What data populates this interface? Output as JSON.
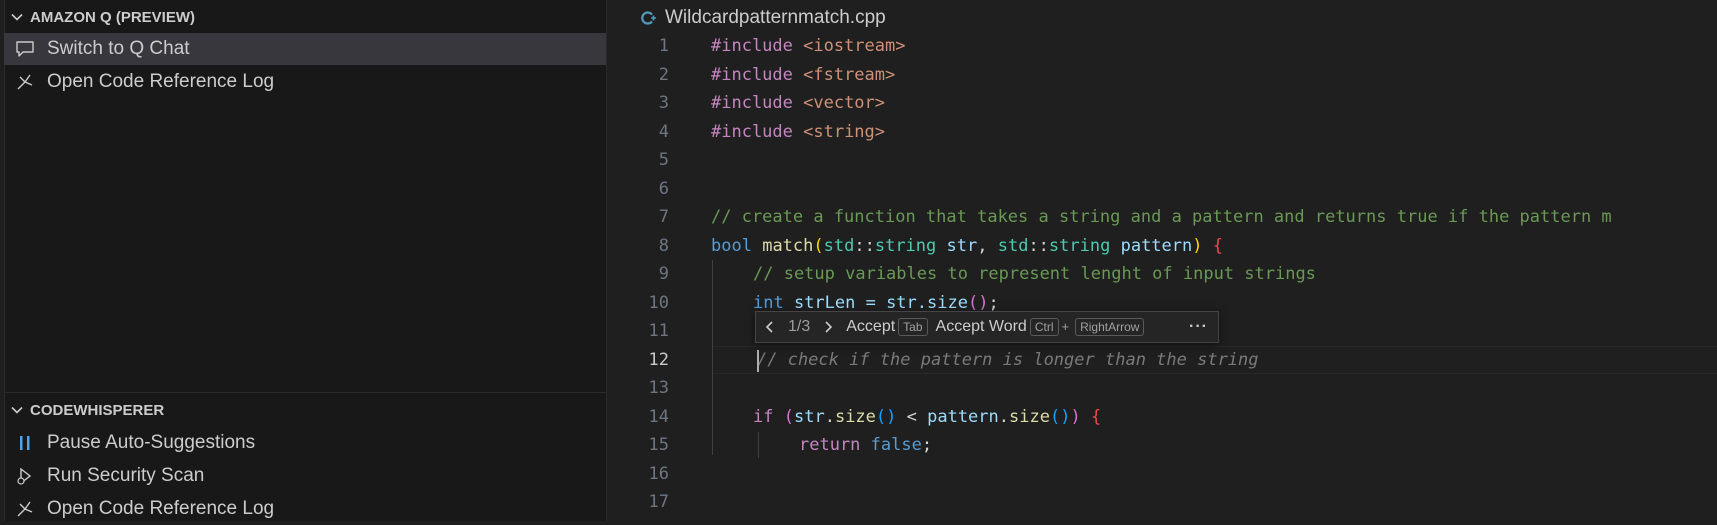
{
  "sidebar": {
    "amazonq": {
      "title": "AMAZON Q (PREVIEW)",
      "items": [
        {
          "label": "Switch to Q Chat",
          "icon": "comment-icon"
        },
        {
          "label": "Open Code Reference Log",
          "icon": "reference-log-icon"
        }
      ]
    },
    "codewhisperer": {
      "title": "CODEWHISPERER",
      "items": [
        {
          "label": "Pause Auto-Suggestions",
          "icon": "pause-icon"
        },
        {
          "label": "Run Security Scan",
          "icon": "security-scan-icon"
        },
        {
          "label": "Open Code Reference Log",
          "icon": "reference-log-icon"
        }
      ]
    }
  },
  "editor": {
    "tab": {
      "filename": "Wildcardpatternmatch.cpp",
      "icon": "cpp-file-icon"
    },
    "line_numbers": [
      "1",
      "2",
      "3",
      "4",
      "5",
      "6",
      "7",
      "8",
      "9",
      "10",
      "11",
      "12",
      "13",
      "14",
      "15",
      "16",
      "17"
    ],
    "active_line": "12",
    "code": {
      "l1": {
        "a": "#include",
        "b": " <iostream>"
      },
      "l2": {
        "a": "#include",
        "b": " <fstream>"
      },
      "l3": {
        "a": "#include",
        "b": " <vector>"
      },
      "l4": {
        "a": "#include",
        "b": " <string>"
      },
      "l7": "// create a function that takes a string and a pattern and returns true if the pattern m",
      "l8": {
        "t1": "bool",
        "t2": " ",
        "t3": "match",
        "t4": "(",
        "t5": "std",
        "t6": "::",
        "t7": "string",
        "t8": " ",
        "t9": "str",
        "t10": ", ",
        "t11": "std",
        "t12": "::",
        "t13": "string",
        "t14": " ",
        "t15": "pattern",
        "t16": ")",
        "t17": " ",
        "t18": "{"
      },
      "l9": "// setup variables to represent lenght of input strings",
      "l10": {
        "t1": "int",
        "t2": " strLen = str.size",
        "t3": "()",
        "t4": ";"
      },
      "l12": "// check if the pattern is longer than the string",
      "l14": {
        "t1": "if",
        "t2": " ",
        "t3": "(",
        "t4": "str",
        "t5": ".",
        "t6": "size",
        "t7": "()",
        "t8": " < ",
        "t9": "pattern",
        "t10": ".",
        "t11": "size",
        "t12": "()",
        "t13": ")",
        "t14": " ",
        "t15": "{"
      },
      "l15": {
        "t1": "return",
        "t2": " ",
        "t3": "false",
        "t4": ";"
      }
    },
    "inline_hint": {
      "counter": "1/3",
      "accept": "Accept",
      "accept_key": "Tab",
      "accept_word": "Accept Word",
      "accept_word_key1": "Ctrl",
      "plus": "+",
      "accept_word_key2": "RightArrow",
      "more": "···"
    }
  }
}
